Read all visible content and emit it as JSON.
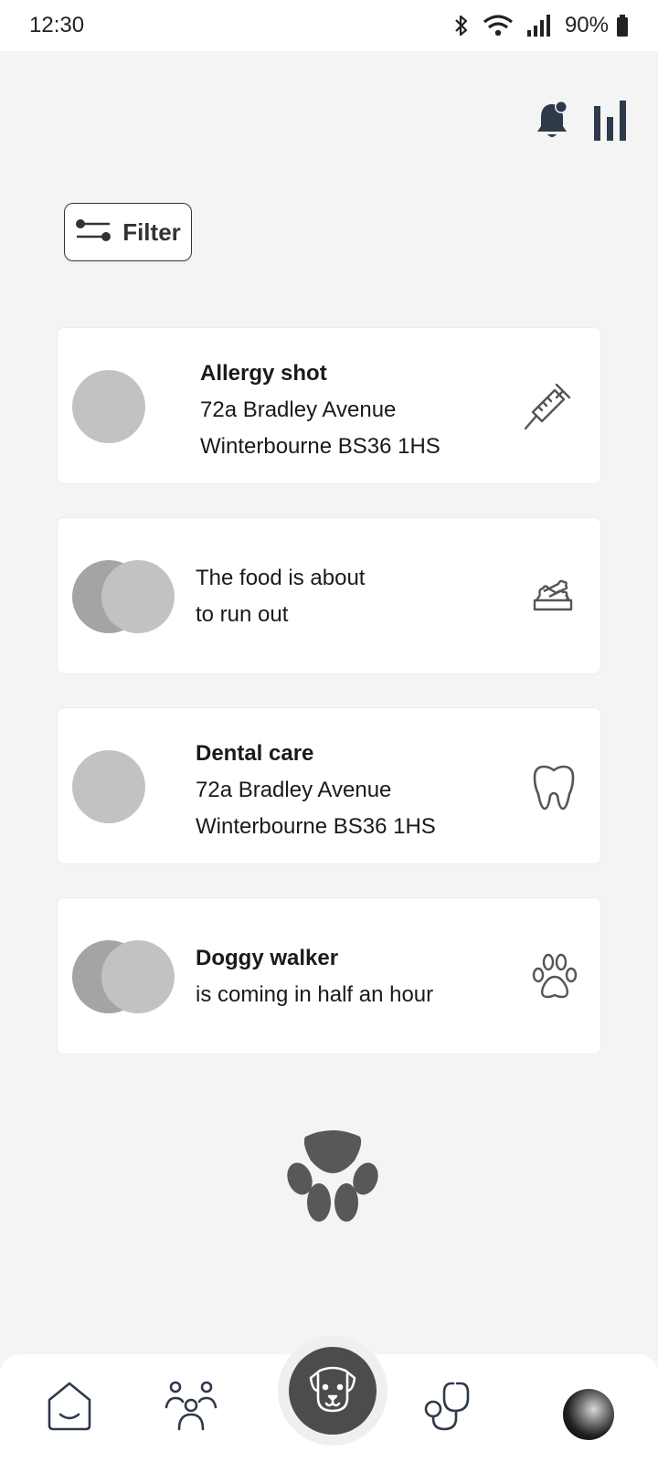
{
  "status_bar": {
    "time": "12:30",
    "battery": "90%",
    "icons": [
      "bluetooth-icon",
      "wifi-icon",
      "signal-icon",
      "battery-icon"
    ]
  },
  "header": {
    "actions": [
      "notification-bell-icon",
      "stats-icon"
    ]
  },
  "filter": {
    "label": "Filter"
  },
  "cards": [
    {
      "title": "Allergy shot",
      "lines": [
        "72a Bradley Avenue",
        "Winterbourne BS36 1HS"
      ],
      "icon": "syringe-icon"
    },
    {
      "title": "",
      "lines": [
        "The food is about",
        "to run out"
      ],
      "icon": "food-bowl-icon"
    },
    {
      "title": "Dental care",
      "lines": [
        "72a Bradley Avenue",
        "Winterbourne BS36 1HS"
      ],
      "icon": "tooth-icon"
    },
    {
      "title": "Doggy walker",
      "lines": [
        "is coming in half an hour"
      ],
      "icon": "paw-icon"
    }
  ],
  "bottom_nav": {
    "items": [
      "home-icon",
      "people-icon",
      "dog-icon",
      "stethoscope-icon",
      "profile-avatar"
    ]
  },
  "colors": {
    "background": "#f5f4f5",
    "card": "#ffffff",
    "accent_dark": "#2e3a4a",
    "nav_center": "#4c4c4c"
  }
}
